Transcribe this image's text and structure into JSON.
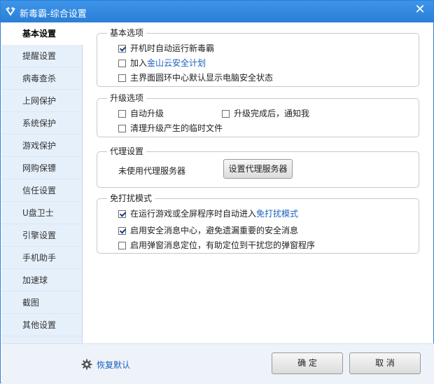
{
  "window": {
    "title": "新毒霸-综合设置"
  },
  "sidebar": {
    "items": [
      {
        "label": "基本设置"
      },
      {
        "label": "提醒设置"
      },
      {
        "label": "病毒查杀"
      },
      {
        "label": "上网保护"
      },
      {
        "label": "系统保护"
      },
      {
        "label": "游戏保护"
      },
      {
        "label": "网购保镖"
      },
      {
        "label": "信任设置"
      },
      {
        "label": "U盘卫士"
      },
      {
        "label": "引擎设置"
      },
      {
        "label": "手机助手"
      },
      {
        "label": "加速球"
      },
      {
        "label": "截图"
      },
      {
        "label": "其他设置"
      }
    ]
  },
  "basic": {
    "title": "基本选项",
    "autostart": "开机时自动运行新毒霸",
    "join_prefix": "加入",
    "join_link": "金山云安全计划",
    "default_status": "主界面圆环中心默认显示电脑安全状态"
  },
  "upgrade": {
    "title": "升级选项",
    "auto": "自动升级",
    "notify": "升级完成后，通知我",
    "cleanup": "清理升级产生的临时文件"
  },
  "proxy": {
    "title": "代理设置",
    "status": "未使用代理服务器",
    "button": "设置代理服务器"
  },
  "nodisturb": {
    "title": "免打扰模式",
    "game_prefix": "在运行游戏或全屏程序时自动进入",
    "game_link": "免打扰模式",
    "security_msg": "启用安全消息中心，避免遗漏重要的安全消息",
    "popup_locate": "启用弹窗消息定位，有助定位到干扰您的弹窗程序"
  },
  "footer": {
    "restore": "恢复默认",
    "ok": "确 定",
    "cancel": "取 消"
  },
  "colors": {
    "accent": "#2a7fd6",
    "link": "#1b5fc1",
    "sidebar_bg": "#e6f0fb"
  }
}
